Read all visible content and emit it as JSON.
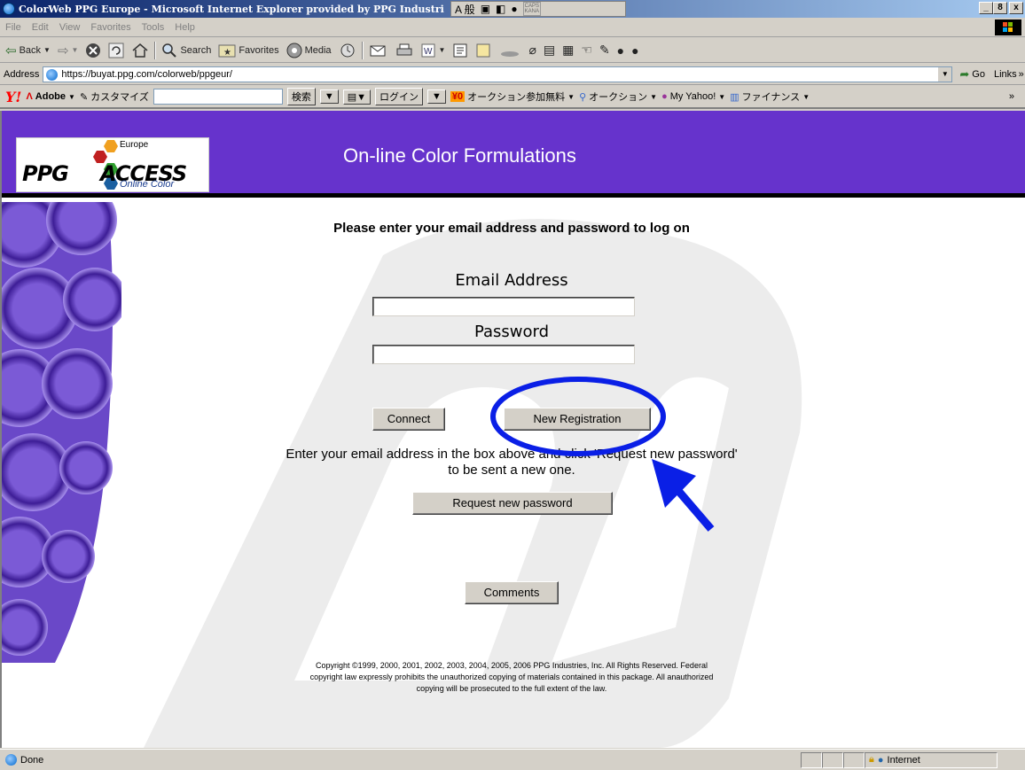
{
  "window": {
    "title": "ColorWeb PPG Europe - Microsoft Internet Explorer provided by PPG Industri",
    "ime_text": "A 般 ",
    "ime_caps": "CAPS KANA",
    "min": "_",
    "max": "8",
    "close": "x"
  },
  "menu": [
    "File",
    "Edit",
    "View",
    "Favorites",
    "Tools",
    "Help"
  ],
  "toolbar": {
    "back": "Back",
    "search": "Search",
    "favorites": "Favorites",
    "media": "Media"
  },
  "address": {
    "label": "Address",
    "url": "https://buyat.ppg.com/colorweb/ppgeur/",
    "go": "Go",
    "links": "Links"
  },
  "yahoo": {
    "adobe": "Adobe",
    "customize": "カスタマイズ",
    "search": "検索",
    "login": "ログイン",
    "auction_free": "オークション参加無料",
    "auction": "オークション",
    "my_yahoo": "My Yahoo!",
    "finance": "ファイナンス",
    "more": "»"
  },
  "header": {
    "logo_ppg": "PPG",
    "logo_access": "ACCESS",
    "logo_europe": "Europe",
    "logo_online": "Online Color",
    "title": "On-line Color Formulations"
  },
  "form": {
    "prompt": "Please enter your email address and password to log on",
    "email_label": "Email Address",
    "password_label": "Password",
    "email_value": "",
    "password_value": "",
    "connect": "Connect",
    "new_registration": "New Registration",
    "help_line1": "Enter your email address in the box above and click 'Request new password'",
    "help_line2": "to be sent a new one.",
    "request_password": "Request new password",
    "comments": "Comments"
  },
  "copyright": {
    "line1": "Copyright ©1999, 2000, 2001, 2002, 2003, 2004, 2005, 2006 PPG Industries, Inc. All Rights Reserved. Federal",
    "line2": "copyright law expressly prohibits the unauthorized copying of materials contained in this package. All anauthorized",
    "line3": "copying will be prosecuted to the full extent of the law."
  },
  "status": {
    "text": "Done",
    "zone": "Internet"
  },
  "colors": {
    "header_purple": "#6633cc",
    "annotation_blue": "#0a1fe6"
  }
}
